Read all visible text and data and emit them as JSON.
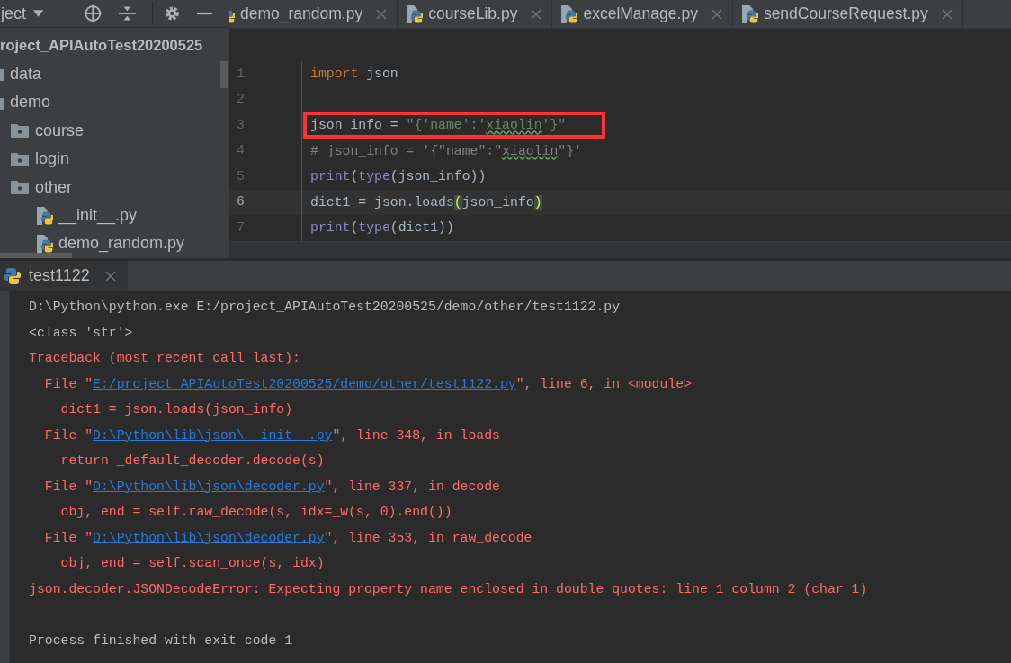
{
  "project_panel": {
    "title": "ject",
    "tree": [
      {
        "label": "roject_APIAutoTest20200525",
        "kind": "root",
        "children": [
          {
            "label": "data",
            "kind": "folder"
          },
          {
            "label": "demo",
            "kind": "folder",
            "children": [
              {
                "label": "course",
                "kind": "package"
              },
              {
                "label": "login",
                "kind": "package"
              },
              {
                "label": "other",
                "kind": "package",
                "children": [
                  {
                    "label": "__init__.py",
                    "kind": "python"
                  },
                  {
                    "label": "demo_random.py",
                    "kind": "python"
                  }
                ]
              }
            ]
          }
        ]
      }
    ]
  },
  "editor_tabs": [
    {
      "label": "demo_random.py",
      "selected": false
    },
    {
      "label": "courseLib.py",
      "selected": false
    },
    {
      "label": "excelManage.py",
      "selected": false
    },
    {
      "label": "sendCourseRequest.py",
      "selected": false
    }
  ],
  "editor": {
    "lines": [
      {
        "number": "1",
        "current": false,
        "boxed": false,
        "tokens": [
          {
            "text": "import",
            "kind": "keyword"
          },
          {
            "text": " json",
            "kind": "plain"
          }
        ]
      },
      {
        "number": "2",
        "current": false,
        "boxed": false
      },
      {
        "number": "3",
        "current": false,
        "boxed": true,
        "tokens": [
          {
            "text": "json_info = ",
            "kind": "plain"
          },
          {
            "text": "\"{'name':'",
            "kind": "string"
          },
          {
            "text": "xiaolin",
            "kind": "string",
            "typo": true
          },
          {
            "text": "'}\"",
            "kind": "string"
          }
        ]
      },
      {
        "number": "4",
        "current": false,
        "boxed": false,
        "tokens": [
          {
            "text": "# json_info = '{\"name\":\"",
            "kind": "comment"
          },
          {
            "text": "xiaolin",
            "kind": "comment",
            "typo": true
          },
          {
            "text": "\"}'",
            "kind": "comment"
          }
        ]
      },
      {
        "number": "5",
        "current": false,
        "boxed": false,
        "tokens": [
          {
            "text": "print",
            "kind": "builtin"
          },
          {
            "text": "(",
            "kind": "plain"
          },
          {
            "text": "type",
            "kind": "builtin"
          },
          {
            "text": "(json_info))",
            "kind": "plain"
          }
        ]
      },
      {
        "number": "6",
        "current": true,
        "boxed": false,
        "tokens": [
          {
            "text": "dict1 = json.loads",
            "kind": "plain"
          },
          {
            "text": "(",
            "kind": "bracket"
          },
          {
            "text": "json_info",
            "kind": "plain"
          },
          {
            "text": ")",
            "kind": "bracket"
          }
        ]
      },
      {
        "number": "7",
        "current": false,
        "boxed": false,
        "tokens": [
          {
            "text": "print",
            "kind": "builtin"
          },
          {
            "text": "(",
            "kind": "plain"
          },
          {
            "text": "type",
            "kind": "builtin"
          },
          {
            "text": "(dict1))",
            "kind": "plain"
          }
        ]
      }
    ]
  },
  "run_tabs": [
    {
      "label": "test1122",
      "selected": true
    }
  ],
  "console": [
    {
      "kind": "text",
      "segments": [
        {
          "text": "D:\\Python\\python.exe E:/project_APIAutoTest20200525/demo/other/test1122.py",
          "kind": "output"
        }
      ]
    },
    {
      "kind": "text",
      "segments": [
        {
          "text": "<class 'str'>",
          "kind": "output"
        }
      ]
    },
    {
      "kind": "text",
      "segments": [
        {
          "text": "Traceback (most recent call last):",
          "kind": "error"
        }
      ]
    },
    {
      "kind": "text",
      "segments": [
        {
          "text": "  File \"",
          "kind": "error"
        },
        {
          "text": "E:/project_APIAutoTest20200525/demo/other/test1122.py",
          "kind": "link"
        },
        {
          "text": "\", line 6, in <module>",
          "kind": "error"
        }
      ]
    },
    {
      "kind": "text",
      "segments": [
        {
          "text": "    dict1 = json.loads(json_info)",
          "kind": "error"
        }
      ]
    },
    {
      "kind": "text",
      "segments": [
        {
          "text": "  File \"",
          "kind": "error"
        },
        {
          "text": "D:\\Python\\lib\\json\\__init__.py",
          "kind": "link"
        },
        {
          "text": "\", line 348, in loads",
          "kind": "error"
        }
      ]
    },
    {
      "kind": "text",
      "segments": [
        {
          "text": "    return _default_decoder.decode(s)",
          "kind": "error"
        }
      ]
    },
    {
      "kind": "text",
      "segments": [
        {
          "text": "  File \"",
          "kind": "error"
        },
        {
          "text": "D:\\Python\\lib\\json\\decoder.py",
          "kind": "link"
        },
        {
          "text": "\", line 337, in decode",
          "kind": "error"
        }
      ]
    },
    {
      "kind": "text",
      "segments": [
        {
          "text": "    obj, end = self.raw_decode(s, idx=_w(s, 0).end())",
          "kind": "error"
        }
      ]
    },
    {
      "kind": "text",
      "segments": [
        {
          "text": "  File \"",
          "kind": "error"
        },
        {
          "text": "D:\\Python\\lib\\json\\decoder.py",
          "kind": "link"
        },
        {
          "text": "\", line 353, in raw_decode",
          "kind": "error"
        }
      ]
    },
    {
      "kind": "text",
      "segments": [
        {
          "text": "    obj, end = self.scan_once(s, idx)",
          "kind": "error"
        }
      ]
    },
    {
      "kind": "text",
      "segments": [
        {
          "text": "json.decoder.JSONDecodeError: Expecting property name enclosed in double quotes: line 1 column 2 (char 1)",
          "kind": "error"
        }
      ]
    },
    {
      "kind": "blank"
    },
    {
      "kind": "text",
      "segments": [
        {
          "text": "Process finished with exit code 1",
          "kind": "output"
        }
      ]
    }
  ]
}
